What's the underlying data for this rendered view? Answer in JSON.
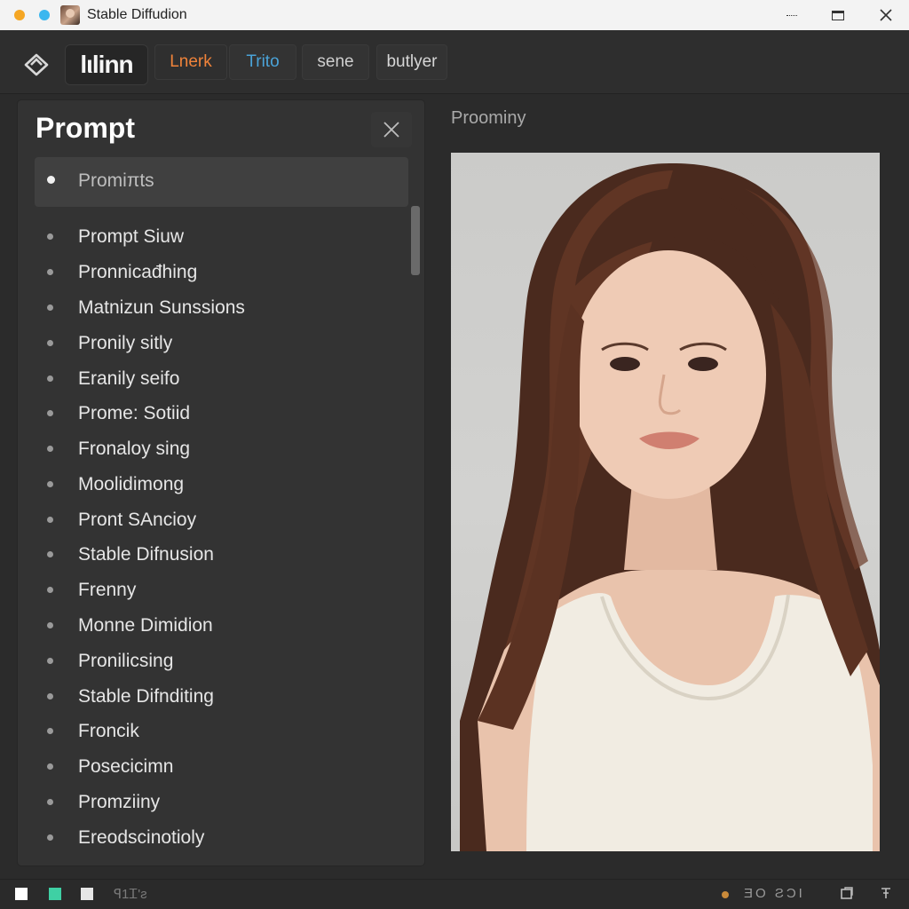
{
  "window": {
    "title": "Stable Diffudion"
  },
  "toolbar": {
    "brand": "lιlinn",
    "tabs": [
      {
        "label": "Lnerk",
        "color": "#f0833a"
      },
      {
        "label": "Trito",
        "color": "#4aa3d8"
      },
      {
        "label": "sene",
        "color": "#cfcfcf"
      },
      {
        "label": "butlyer",
        "color": "#d6d6d6"
      }
    ]
  },
  "prompt_panel": {
    "title": "Prompt",
    "selected_item": "Promiπts",
    "items": [
      "Prompt Siuw",
      "Pronnicađhing",
      "Matnizun Sunssions",
      "Pronily sitly",
      "Eranily seifo",
      "Prome: Sotiid",
      "Fronaloy sing",
      "Moolidimong",
      "Pront SAncioy",
      "Stable Difnusion",
      "Frenny",
      "Monne Dimidion",
      "Pronilicsing",
      "Stable Difnditing",
      "Froncik",
      "Posecicimn",
      "Promziiny",
      "Ereodscinotioly"
    ]
  },
  "preview": {
    "label": "Proominy",
    "image_description_icon": "portrait-image"
  },
  "statusbar": {
    "left_text": "ꟼ1Ꮖ'ƨ",
    "right_text": "ƎO ƧƆI",
    "accent": "#3fd0a4"
  }
}
